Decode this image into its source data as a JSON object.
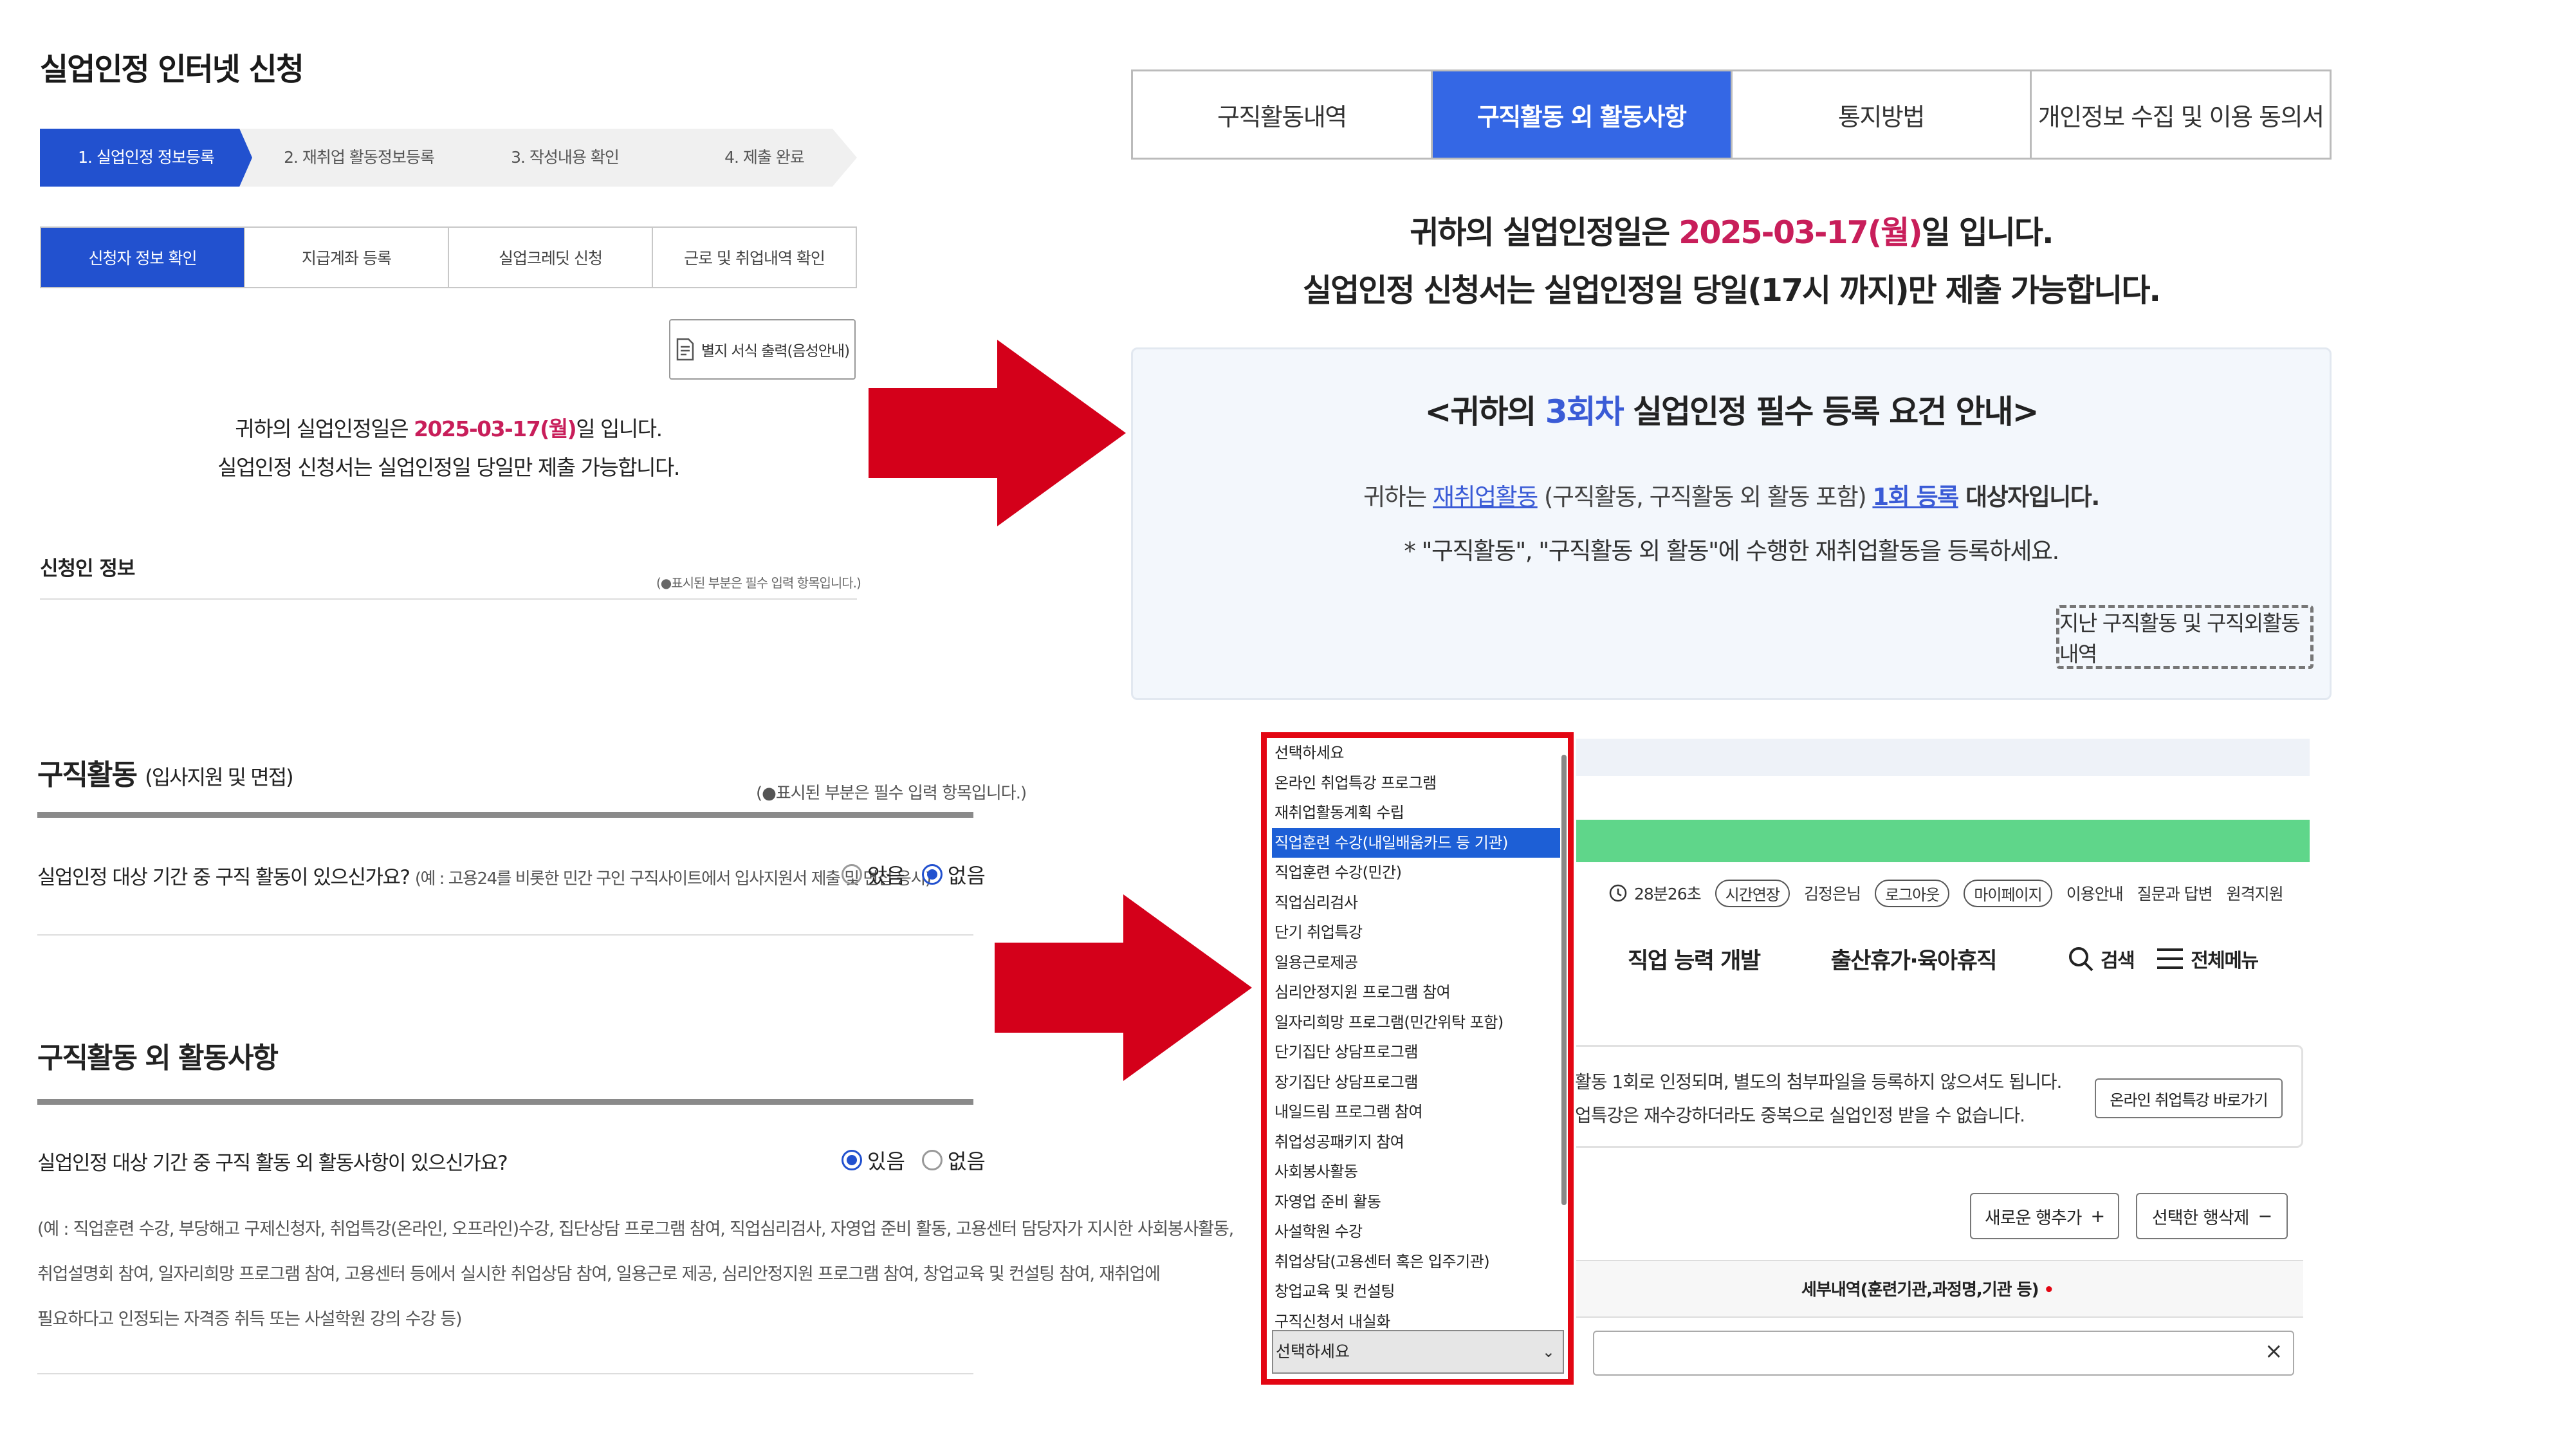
{
  "left": {
    "page_title": "실업인정 인터넷 신청",
    "steps": [
      "1. 실업인정 정보등록",
      "2. 재취업 활동정보등록",
      "3. 작성내용 확인",
      "4. 제출 완료"
    ],
    "subtabs": [
      "신청자 정보 확인",
      "지급계좌 등록",
      "실업크레딧 신청",
      "근로 및 취업내역 확인"
    ],
    "print_button": "별지 서식 출력(음성안내)",
    "notice_prefix": "귀하의 실업인정일은 ",
    "notice_date": "2025-03-17(월)",
    "notice_suffix": "일 입니다.",
    "notice_line2": "실업인정 신청서는 실업인정일 당일만 제출 가능합니다.",
    "applicant_title": "신청인 정보",
    "required_note": "(●표시된 부분은 필수 입력 항목입니다.)",
    "job_search": {
      "title": "구직활동",
      "subtitle": "(입사지원 및 면접)",
      "required_note": "(●표시된 부분은 필수 입력 항목입니다.)",
      "question": "실업인정 대상 기간 중 구직 활동이 있으신가요?",
      "question_note": "(예 : 고용24를 비롯한 민간 구인 구직사이트에서 입사지원서 제출 및 면접 응시)",
      "yes": "있음",
      "no": "없음",
      "selected": "no"
    },
    "other_activity": {
      "title": "구직활동 외 활동사항",
      "question": "실업인정 대상 기간 중 구직 활동 외 활동사항이 있으신가요?",
      "yes": "있음",
      "no": "없음",
      "selected": "yes",
      "example_lines": [
        "(예 : 직업훈련 수강, 부당해고 구제신청자, 취업특강(온라인, 오프라인)수강, 집단상담 프로그램 참여, 직업심리검사, 자영업 준비 활동, 고용센터 담당자가 지시한 사회봉사활동,",
        "취업설명회 참여, 일자리희망 프로그램 참여, 고용센터 등에서 실시한 취업상담 참여, 일용근로 제공, 심리안정지원 프로그램 참여, 창업교육 및 컨설팅 참여, 재취업에",
        "필요하다고 인정되는 자격증 취득 또는 사설학원 강의 수강 등)"
      ]
    }
  },
  "right": {
    "tabs": [
      "구직활동내역",
      "구직활동 외 활동사항",
      "통지방법",
      "개인정보 수집 및 이용 동의서"
    ],
    "active_tab": 1,
    "notice_prefix": "귀하의 실업인정일은 ",
    "notice_date": "2025-03-17(월)",
    "notice_suffix": "일 입니다.",
    "notice_line2": "실업인정 신청서는 실업인정일 당일(17시 까지)만 제출 가능합니다.",
    "guide": {
      "title_prefix": "<귀하의 ",
      "title_round": "3회차",
      "title_suffix": " 실업인정 필수 등록 요건 안내>",
      "line1_prefix": "귀하는 ",
      "line1_link": "재취업활동",
      "line1_mid": " (구직활동, 구직활동 외 활동 포함) ",
      "line1_count": "1회 등록",
      "line1_suffix": " 대상자입니다.",
      "line2": "* \"구직활동\", \"구직활동 외 활동\"에 수행한 재취업활동을 등록하세요.",
      "past_button": "지난 구직활동 및 구직외활동내역"
    },
    "background": {
      "util": {
        "time": "28분26초",
        "extend": "시간연장",
        "user": "김정은님",
        "logout": "로그아웃",
        "mypage": "마이페이지",
        "guide": "이용안내",
        "qa": "질문과 답변",
        "remote": "원격지원"
      },
      "nav": {
        "item1": "직업 능력 개발",
        "item2": "출산휴가·육아휴직",
        "search": "검색",
        "menu": "전체메뉴"
      },
      "info_line1": "활동 1회로 인정되며, 별도의 첨부파일을 등록하지 않으셔도 됩니다.",
      "info_line2": "업특강은 재수강하더라도 중복으로 실업인정 받을 수 없습니다.",
      "online_button": "온라인 취업특강 바로가기",
      "add_row": "새로운 행추가",
      "delete_row": "선택한 행삭제",
      "detail_header": "세부내역(훈련기관,과정명,기관 등)",
      "clear": "×"
    },
    "dropdown": {
      "options": [
        "선택하세요",
        "온라인 취업특강 프로그램",
        "재취업활동계획 수립",
        "직업훈련 수강(내일배움카드 등 기관)",
        "직업훈련 수강(민간)",
        "직업심리검사",
        "단기 취업특강",
        "일용근로제공",
        "심리안정지원 프로그램 참여",
        "일자리희망 프로그램(민간위탁 포함)",
        "단기집단 상담프로그램",
        "장기집단 상담프로그램",
        "내일드림 프로그램 참여",
        "취업성공패키지 참여",
        "사회봉사활동",
        "자영업 준비 활동",
        "사설학원 수강",
        "취업상담(고용센터 혹은 입주기관)",
        "창업교육 및 컨설팅",
        "구직신청서 내실화"
      ],
      "highlighted_index": 3,
      "current_value": "선택하세요"
    }
  },
  "colors": {
    "primary_blue": "#2251cf",
    "tab_blue": "#3467e5",
    "date_red": "#c81e5a",
    "arrow_red": "#d4001a",
    "frame_red": "#e30613",
    "green_bar": "#5fd68a"
  }
}
